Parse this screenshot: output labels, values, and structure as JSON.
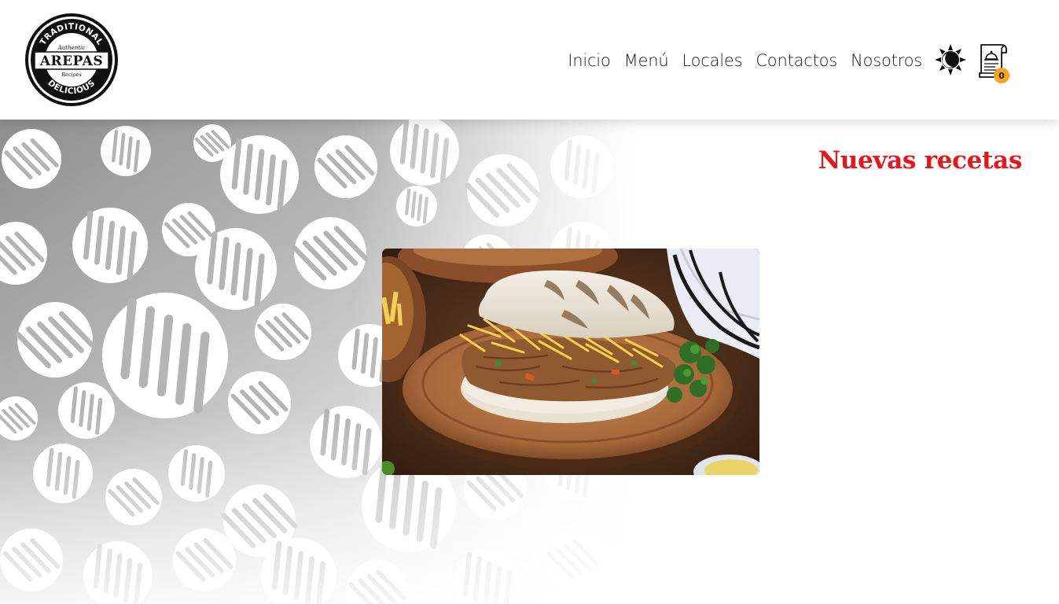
{
  "header": {
    "logo": {
      "alt": "Arepas logo",
      "top_text": "TRADITIONAL",
      "script_text": "Authentic",
      "main_text": "AREPAS",
      "sub_text": "Recipes",
      "bottom_text": "DELICIOUS"
    },
    "nav": {
      "items": [
        {
          "label": "Inicio"
        },
        {
          "label": "Menú"
        },
        {
          "label": "Locales"
        },
        {
          "label": "Contactos"
        },
        {
          "label": "Nosotros"
        }
      ]
    },
    "theme_toggle": {
      "icon": "sun-moon-icon"
    },
    "cart": {
      "icon": "order-receipt-icon",
      "count": "0",
      "badge_color": "#f5a623"
    }
  },
  "main": {
    "section_title": "Nuevas recetas",
    "title_color": "#e8161b",
    "featured_image": {
      "alt": "Arepa rellena de carne mechada y queso"
    }
  }
}
